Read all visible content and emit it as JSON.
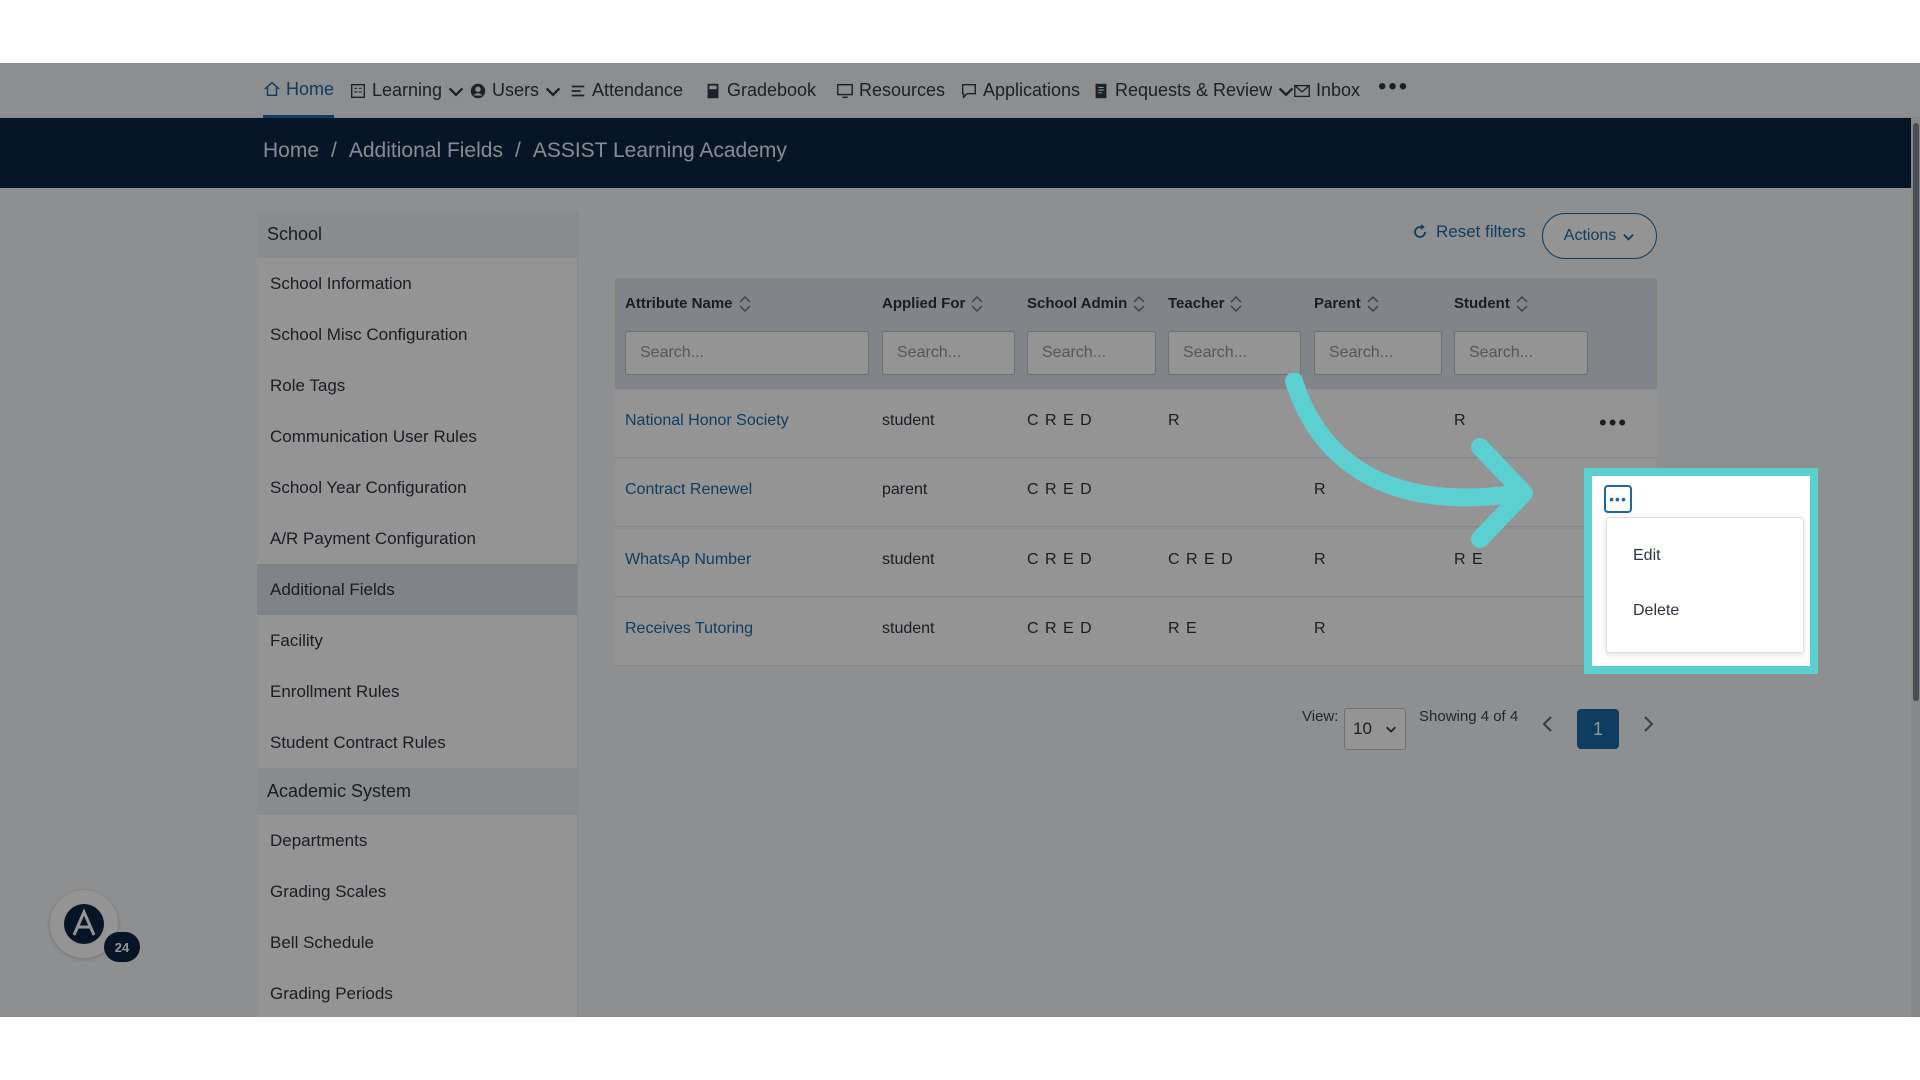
{
  "nav": {
    "items": [
      {
        "label": "Home",
        "icon": "home-icon"
      },
      {
        "label": "Learning",
        "icon": "grid-icon"
      },
      {
        "label": "Users",
        "icon": "user-icon"
      },
      {
        "label": "Attendance",
        "icon": "list-icon"
      },
      {
        "label": "Gradebook",
        "icon": "book-icon"
      },
      {
        "label": "Resources",
        "icon": "monitor-icon"
      },
      {
        "label": "Applications",
        "icon": "chat-icon"
      },
      {
        "label": "Requests & Review",
        "icon": "doc-icon"
      },
      {
        "label": "Inbox",
        "icon": "mail-icon"
      }
    ],
    "more": "•••"
  },
  "breadcrumb": {
    "home": "Home",
    "sep": "/",
    "section": "Additional Fields",
    "page": "ASSIST Learning Academy"
  },
  "sidebar": {
    "school_header": "School",
    "school_items": [
      "School Information",
      "School Misc Configuration",
      "Role Tags",
      "Communication User Rules",
      "School Year Configuration",
      "A/R Payment Configuration",
      "Additional Fields",
      "Facility",
      "Enrollment Rules",
      "Student Contract Rules"
    ],
    "academic_header": "Academic System",
    "academic_items": [
      "Departments",
      "Grading Scales",
      "Bell Schedule",
      "Grading Periods"
    ]
  },
  "toolbar": {
    "reset": "Reset filters",
    "actions": "Actions"
  },
  "table": {
    "headers": [
      "Attribute Name",
      "Applied For",
      "School Admin",
      "Teacher",
      "Parent",
      "Student"
    ],
    "search_placeholder": "Search...",
    "rows": [
      {
        "name": "National Honor Society",
        "applied": "student",
        "admin": "C R E D",
        "teacher": "R",
        "parent": "",
        "student": "R"
      },
      {
        "name": "Contract Renewel",
        "applied": "parent",
        "admin": "C R E D",
        "teacher": "",
        "parent": "R",
        "student": ""
      },
      {
        "name": "WhatsAp Number",
        "applied": "student",
        "admin": "C R E D",
        "teacher": "C R E D",
        "parent": "R",
        "student": "R E"
      },
      {
        "name": "Receives Tutoring",
        "applied": "student",
        "admin": "C R E D",
        "teacher": "R E",
        "parent": "R",
        "student": ""
      }
    ],
    "row_menu": "•••"
  },
  "pager": {
    "view_label": "View:",
    "per_page": "10",
    "showing": "Showing 4 of 4",
    "page": "1"
  },
  "popup": {
    "dots": "•••",
    "edit": "Edit",
    "delete": "Delete"
  },
  "badge": {
    "count": "24"
  },
  "colors": {
    "accent": "#1a6aa8",
    "header": "#0a2540",
    "highlight": "#5ccfd0"
  }
}
